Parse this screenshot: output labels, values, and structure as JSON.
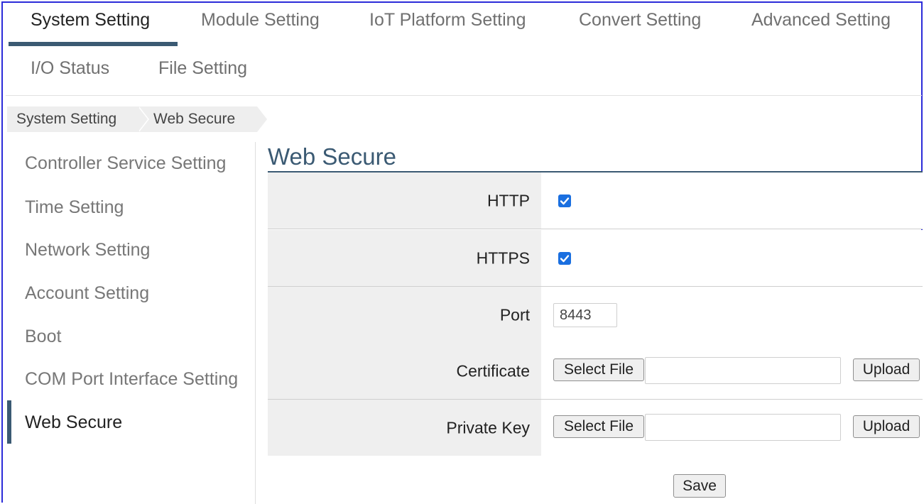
{
  "tabs": {
    "row1": [
      "System Setting",
      "Module Setting",
      "IoT Platform Setting",
      "Convert Setting",
      "Advanced Setting"
    ],
    "row2": [
      "I/O Status",
      "File Setting"
    ],
    "active": "System Setting"
  },
  "breadcrumb": [
    "System Setting",
    "Web Secure"
  ],
  "sidebar": {
    "items": [
      "Controller Service Setting",
      "Time Setting",
      "Network Setting",
      "Account Setting",
      "Boot",
      "COM Port Interface Setting",
      "Web Secure"
    ],
    "active": "Web Secure"
  },
  "main": {
    "title": "Web Secure",
    "http_label": "HTTP",
    "http_checked": true,
    "https_label": "HTTPS",
    "https_checked": true,
    "port_label": "Port",
    "port_value": "8443",
    "certificate_label": "Certificate",
    "private_key_label": "Private Key",
    "select_file_label": "Select File",
    "upload_label": "Upload",
    "save_label": "Save"
  },
  "colors": {
    "accent": "#3b5a73",
    "checkbox": "#1a6fe0",
    "frame": "#2b2bd9"
  }
}
